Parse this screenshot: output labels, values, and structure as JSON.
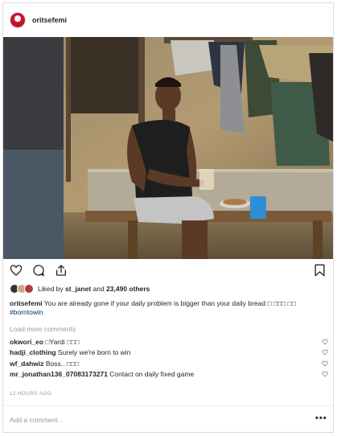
{
  "post": {
    "username": "oritsefemi",
    "likes": {
      "prefix": "Liked by ",
      "user": "st_janet",
      "middle": " and ",
      "count": "23,490 others"
    },
    "caption": {
      "username": "oritsefemi",
      "text": " You are already gone if your daily problem is bigger than your daily bread □ □□□ □□ ",
      "hashtag": "#borntowin"
    },
    "load_more": "Load more comments",
    "comments": [
      {
        "user": "okwori_eo",
        "text": " □Yardi □□□"
      },
      {
        "user": "hadji_clothing",
        "text": " Surely we're born to win"
      },
      {
        "user": "wf_dahwiz",
        "text": " Boss.. □□□"
      },
      {
        "user": "mr_jonathan136_07083173271",
        "text": " Contact on daily fixed game"
      }
    ],
    "timestamp": "12 HOURS AGO",
    "add_comment_placeholder": "Add a comment...",
    "more_label": "•••"
  },
  "icons": [
    "heart-icon",
    "comment-icon",
    "share-icon",
    "bookmark-icon",
    "more-icon"
  ],
  "colors": {
    "link": "#003569",
    "muted": "#999999",
    "border": "#dbdbdb"
  }
}
